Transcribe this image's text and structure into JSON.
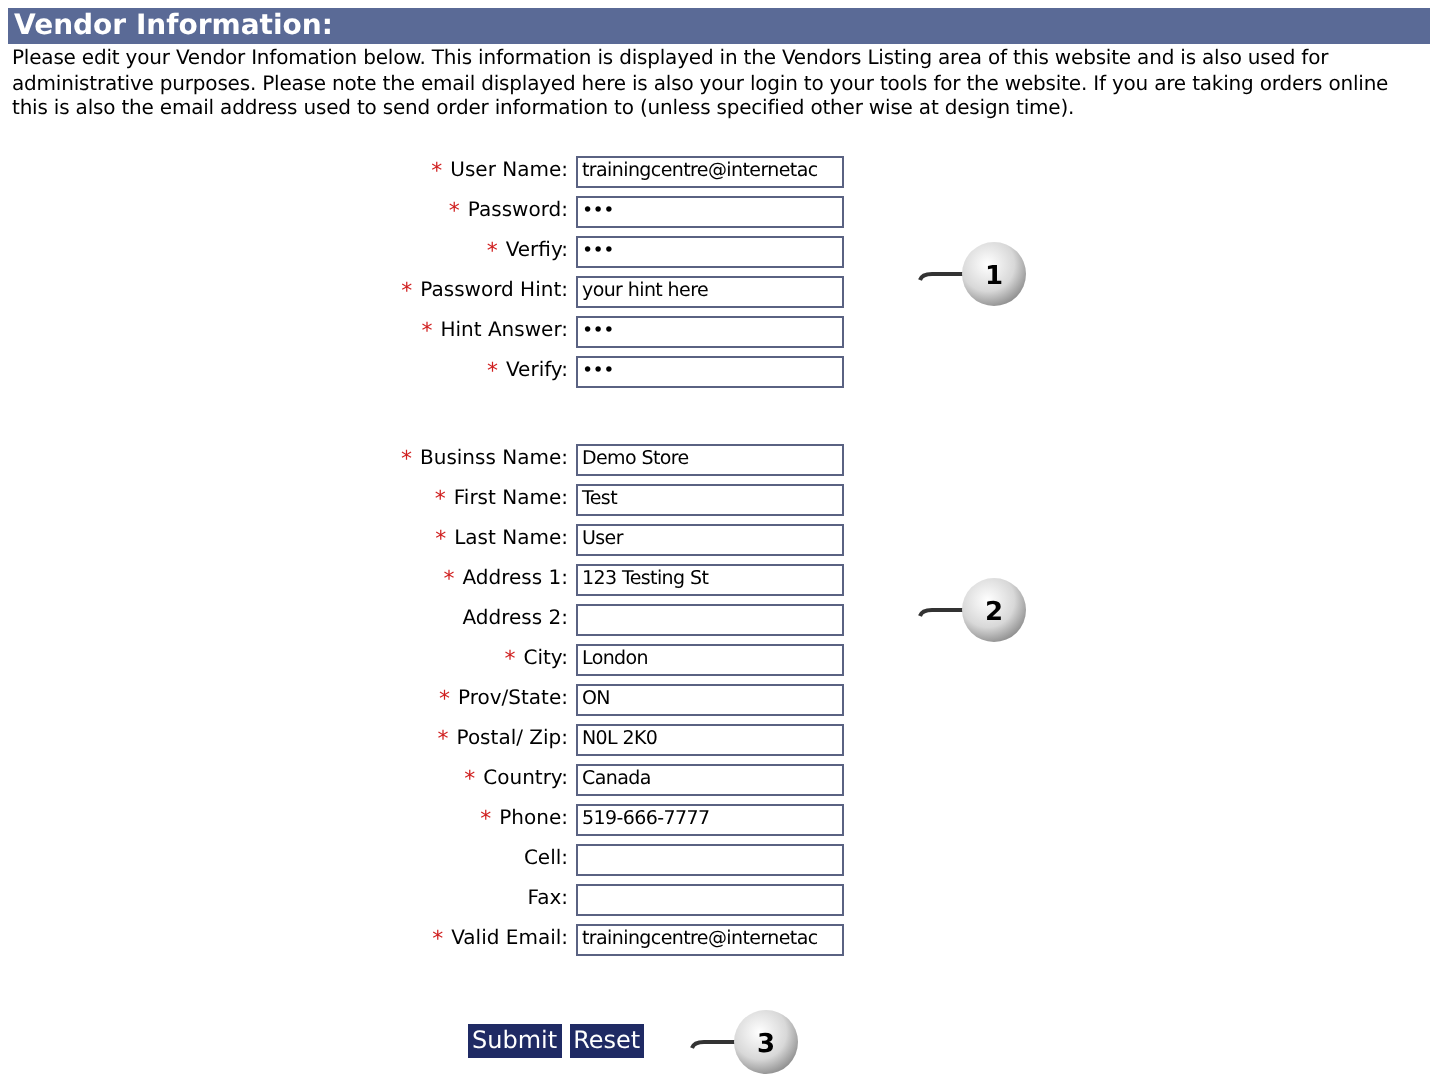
{
  "header": {
    "title": "Vendor Information:"
  },
  "intro": "Please edit your Vendor Infomation below. This information is displayed in the Vendors Listing area of this website and is also used for administrative purposes. Please note the email displayed here is also your login to your tools for the website. If you are taking orders online this is also the email address used to send order information to (unless specified other wise at design time).",
  "sections": [
    {
      "callout": "1",
      "fields": [
        {
          "label": "User Name:",
          "required": true,
          "value": "trainingcentre@internetac"
        },
        {
          "label": "Password:",
          "required": true,
          "value": "•••"
        },
        {
          "label": "Verfiy:",
          "required": true,
          "value": "•••"
        },
        {
          "label": "Password Hint:",
          "required": true,
          "value": "your hint here"
        },
        {
          "label": "Hint Answer:",
          "required": true,
          "value": "•••"
        },
        {
          "label": "Verify:",
          "required": true,
          "value": "•••"
        }
      ]
    },
    {
      "callout": "2",
      "fields": [
        {
          "label": "Businss Name:",
          "required": true,
          "value": "Demo Store"
        },
        {
          "label": "First Name:",
          "required": true,
          "value": "Test"
        },
        {
          "label": "Last Name:",
          "required": true,
          "value": "User"
        },
        {
          "label": "Address 1:",
          "required": true,
          "value": "123 Testing St"
        },
        {
          "label": "Address 2:",
          "required": false
        },
        {
          "label": "City:",
          "required": true,
          "value": "London"
        },
        {
          "label": "Prov/State:",
          "required": true,
          "value": "ON"
        },
        {
          "label": "Postal/ Zip:",
          "required": true,
          "value": "N0L 2K0"
        },
        {
          "label": "Country:",
          "required": true,
          "value": "Canada"
        },
        {
          "label": "Phone:",
          "required": true,
          "value": "519-666-7777"
        },
        {
          "label": "Cell:",
          "required": false
        },
        {
          "label": "Fax:",
          "required": false
        },
        {
          "label": "Valid Email:",
          "required": true,
          "value": "trainingcentre@internetac"
        }
      ]
    }
  ],
  "buttons": [
    "Submit",
    "Reset"
  ],
  "buttons_callout": "3",
  "required_mark": "*"
}
